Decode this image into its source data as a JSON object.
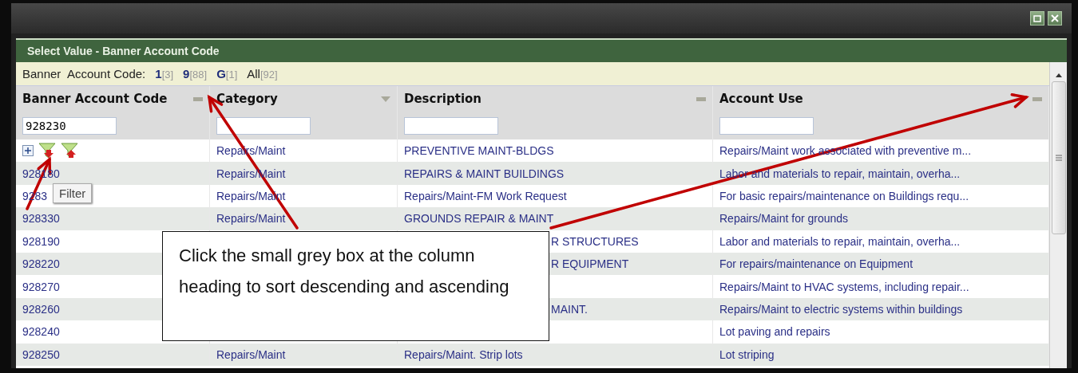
{
  "window": {
    "title": "Select Value - Banner Account Code"
  },
  "letter_filter": {
    "label": "Banner  Account Code:",
    "items": [
      {
        "letter": "1",
        "count": "[3]",
        "selected": false
      },
      {
        "letter": "9",
        "count": "[88]",
        "selected": false
      },
      {
        "letter": "G",
        "count": "[1]",
        "selected": false
      },
      {
        "letter": "All",
        "count": "[92]",
        "selected": true
      }
    ]
  },
  "table": {
    "columns": [
      {
        "title": "Banner Account Code",
        "kind": "box",
        "filter_value": "928230"
      },
      {
        "title": "Category",
        "kind": "triangle"
      },
      {
        "title": "Description",
        "kind": "box"
      },
      {
        "title": "Account Use",
        "kind": "box"
      }
    ],
    "rows": [
      {
        "kind": "tools",
        "category": "Repairs/Maint",
        "description": "PREVENTIVE MAINT-BLDGS",
        "account_use": "Repairs/Maint work associated with preventive m..."
      },
      {
        "kind": "data",
        "code": "928180",
        "category": "Repairs/Maint",
        "description": "REPAIRS & MAINT BUILDINGS",
        "account_use": "Labor and materials to repair, maintain, overha..."
      },
      {
        "kind": "data",
        "code": "9283",
        "category": "Repairs/Maint",
        "description": "Repairs/Maint-FM Work Request",
        "account_use": "For basic repairs/maintenance on Buildings requ..."
      },
      {
        "kind": "data",
        "code": "928330",
        "category": "Repairs/Maint",
        "description": "GROUNDS REPAIR & MAINT",
        "account_use": "Repairs/Maint for grounds"
      },
      {
        "kind": "covered",
        "code": "928190",
        "description": "R STRUCTURES",
        "account_use": "Labor and materials to repair, maintain, overha..."
      },
      {
        "kind": "covered",
        "code": "928220",
        "description": "R EQUIPMENT",
        "account_use": "For repairs/maintenance on Equipment"
      },
      {
        "kind": "covered",
        "code": "928270",
        "account_use": "Repairs/Maint to HVAC systems, including repair..."
      },
      {
        "kind": "covered",
        "code": "928260",
        "description": "MAINT.",
        "account_use": "Repairs/Maint to electric systems within buildings"
      },
      {
        "kind": "covered",
        "code": "928240",
        "account_use": "Lot paving and repairs"
      },
      {
        "kind": "data",
        "code": "928250",
        "category": "Repairs/Maint",
        "description": "Repairs/Maint. Strip lots",
        "account_use": "Lot striping"
      }
    ]
  },
  "tooltip": "Filter",
  "callout": "Click the small grey box at the column heading to sort descending and ascending"
}
